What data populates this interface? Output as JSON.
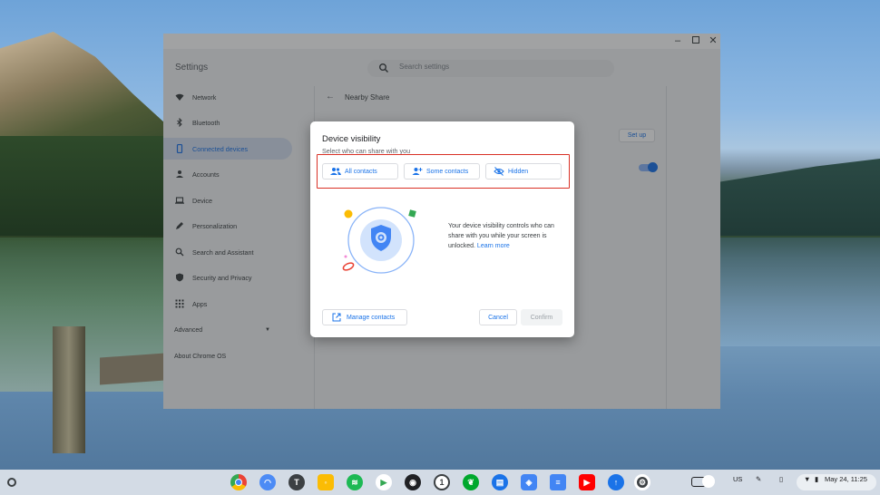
{
  "window": {
    "app_title": "Settings",
    "search_placeholder": "Search settings"
  },
  "sidebar": {
    "items": [
      {
        "label": "Network",
        "icon": "wifi-icon"
      },
      {
        "label": "Bluetooth",
        "icon": "bluetooth-icon"
      },
      {
        "label": "Connected devices",
        "icon": "phone-icon",
        "active": true
      },
      {
        "label": "Accounts",
        "icon": "person-icon"
      },
      {
        "label": "Device",
        "icon": "laptop-icon"
      },
      {
        "label": "Personalization",
        "icon": "pen-icon"
      },
      {
        "label": "Search and Assistant",
        "icon": "search-icon"
      },
      {
        "label": "Security and Privacy",
        "icon": "shield-icon"
      },
      {
        "label": "Apps",
        "icon": "grid-icon"
      }
    ],
    "advanced": "Advanced",
    "about": "About Chrome OS"
  },
  "content": {
    "title": "Nearby Share",
    "setup_label": "Set up"
  },
  "dialog": {
    "title": "Device visibility",
    "subtitle": "Select who can share with you",
    "options": [
      {
        "label": "All contacts",
        "icon": "people-icon"
      },
      {
        "label": "Some contacts",
        "icon": "person-add-icon"
      },
      {
        "label": "Hidden",
        "icon": "eye-off-icon"
      }
    ],
    "description": "Your device visibility controls who can share with you while your screen is unlocked.",
    "learn_more": "Learn more",
    "manage_label": "Manage contacts",
    "cancel_label": "Cancel",
    "confirm_label": "Confirm"
  },
  "shelf": {
    "apps": [
      {
        "name": "chrome",
        "letter": ""
      },
      {
        "name": "app-2",
        "letter": ""
      },
      {
        "name": "app-t",
        "letter": "T"
      },
      {
        "name": "keep",
        "letter": ""
      },
      {
        "name": "spotify",
        "letter": ""
      },
      {
        "name": "play-store",
        "letter": ""
      },
      {
        "name": "app-7",
        "letter": ""
      },
      {
        "name": "1password",
        "letter": "1"
      },
      {
        "name": "evernote",
        "letter": ""
      },
      {
        "name": "messages",
        "letter": ""
      },
      {
        "name": "app-11",
        "letter": ""
      },
      {
        "name": "docs",
        "letter": ""
      },
      {
        "name": "youtube",
        "letter": ""
      },
      {
        "name": "upload",
        "letter": ""
      },
      {
        "name": "settings",
        "letter": ""
      }
    ],
    "ime": "US",
    "datetime": "May 24, 11:25"
  },
  "colors": {
    "accent": "#1a73e8",
    "highlight_border": "#d93025"
  }
}
